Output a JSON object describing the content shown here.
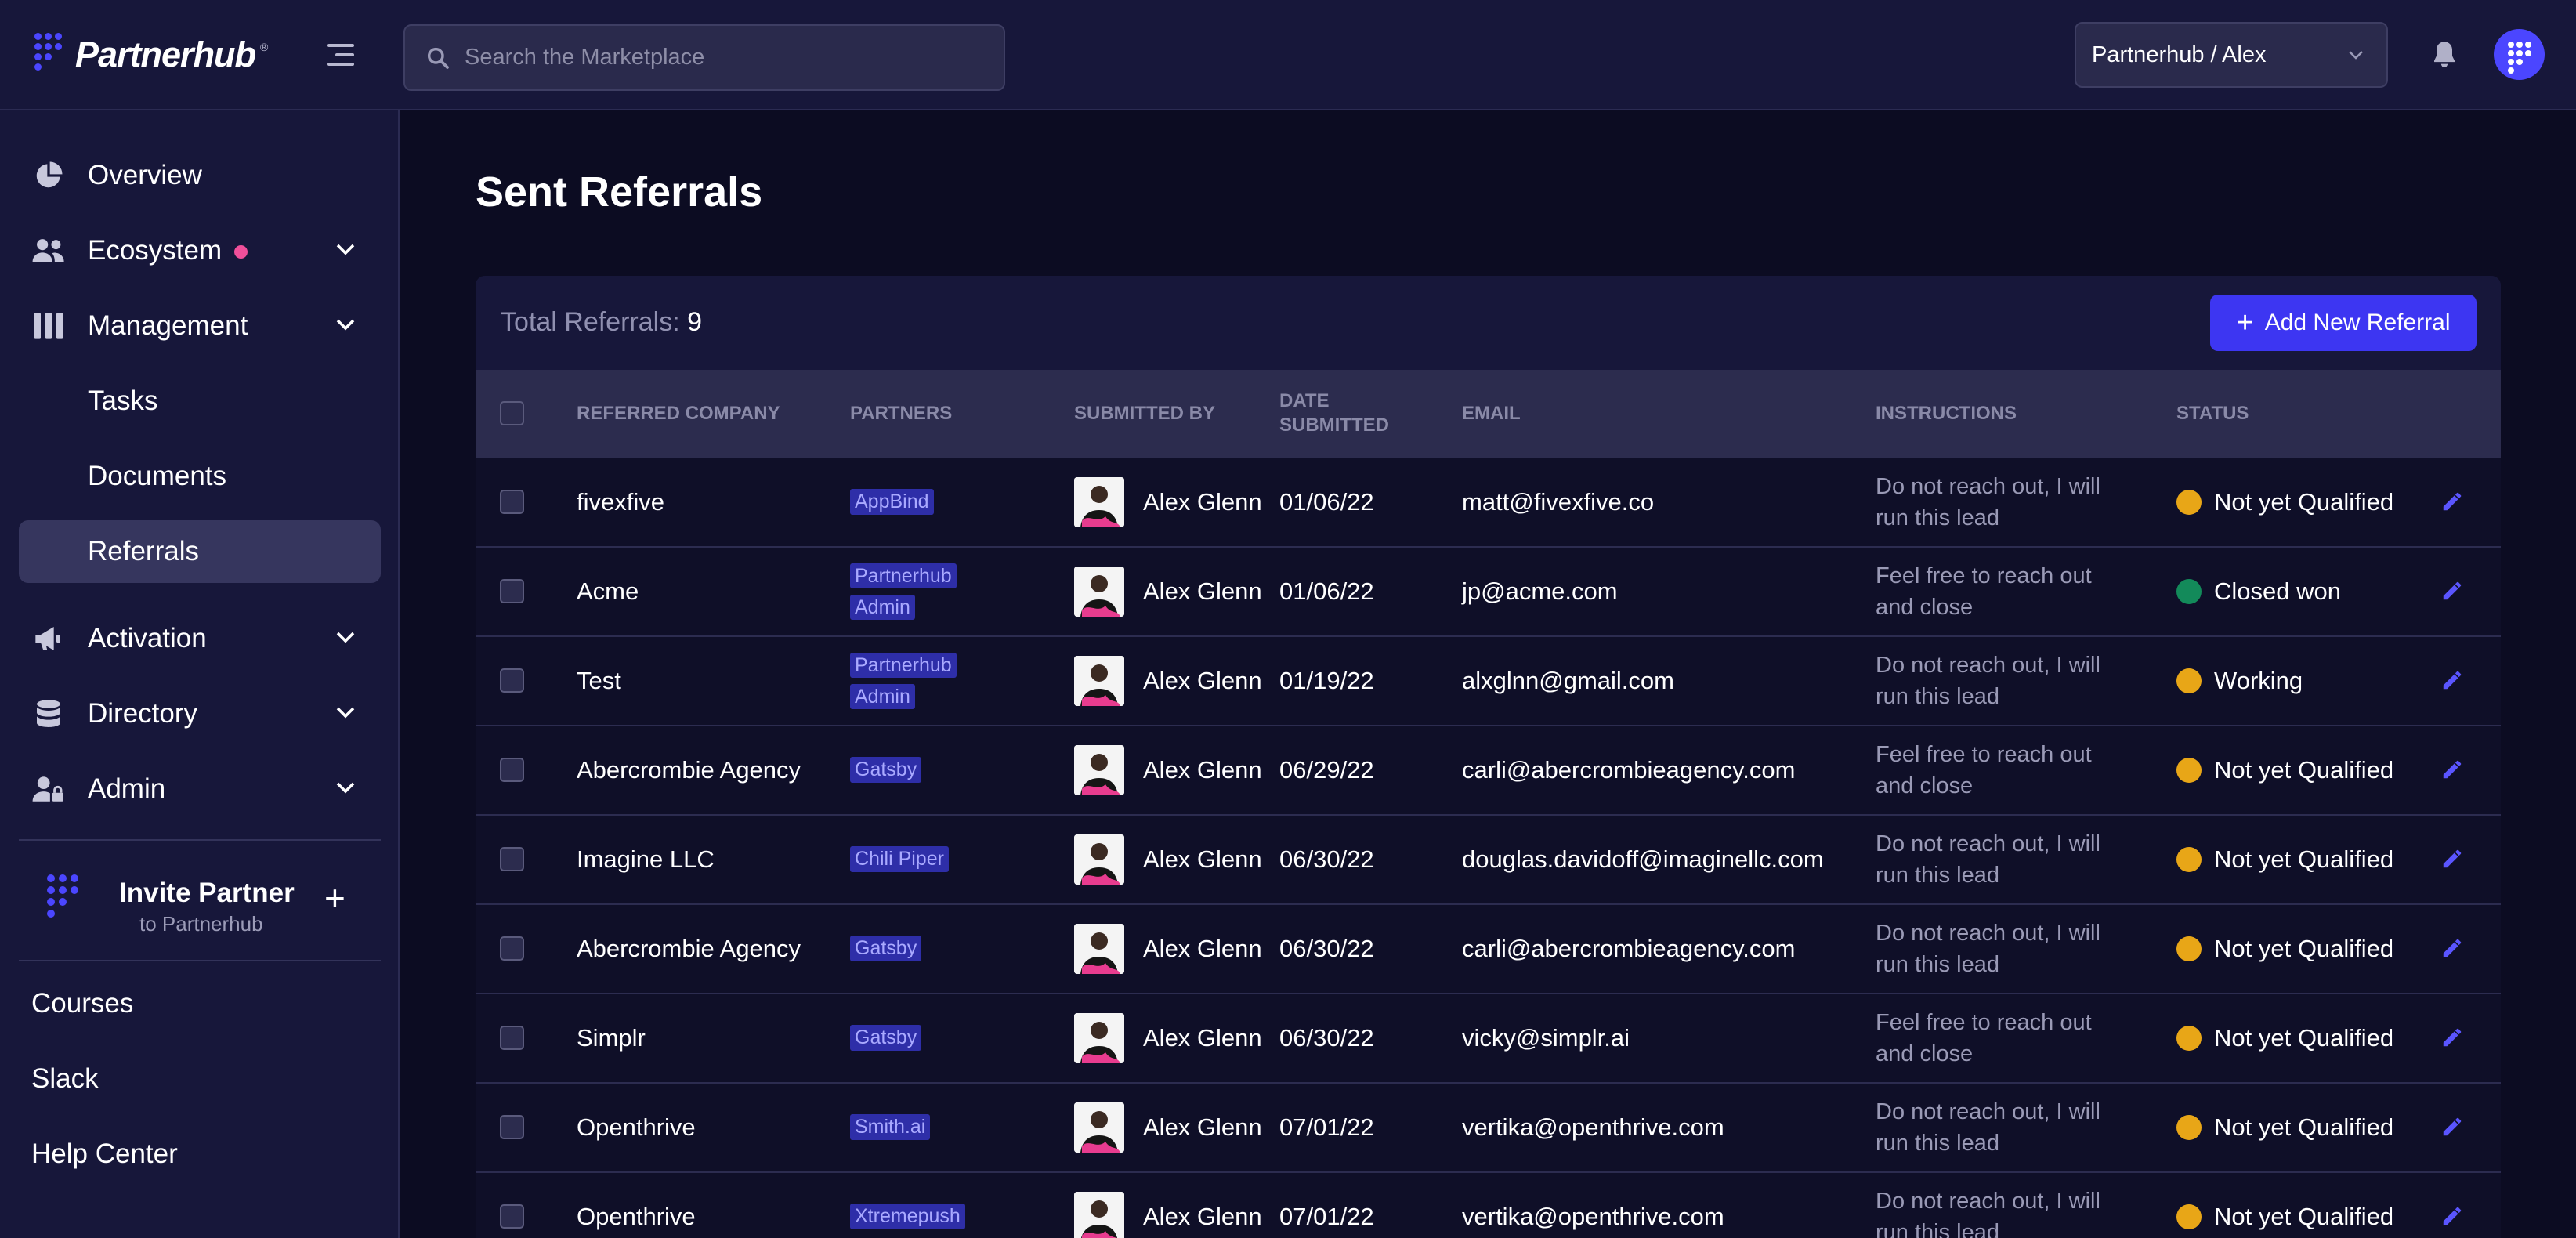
{
  "brand": {
    "name": "Partnerhub",
    "reg": "®",
    "accent": "#4b46ff"
  },
  "search": {
    "placeholder": "Search the Marketplace"
  },
  "workspace": {
    "label": "Partnerhub / Alex"
  },
  "sidebar": {
    "items": [
      {
        "label": "Overview",
        "icon": "pie-chart-icon"
      },
      {
        "label": "Ecosystem",
        "icon": "people-icon",
        "has_dot": true
      },
      {
        "label": "Management",
        "icon": "columns-icon"
      },
      {
        "label": "Tasks"
      },
      {
        "label": "Documents"
      },
      {
        "label": "Referrals",
        "active": true
      },
      {
        "label": "Activation",
        "icon": "megaphone-icon"
      },
      {
        "label": "Directory",
        "icon": "database-icon"
      },
      {
        "label": "Admin",
        "icon": "user-lock-icon"
      }
    ],
    "invite": {
      "title": "Invite Partner",
      "subtitle": "to Partnerhub"
    },
    "bottom_links": [
      "Courses",
      "Slack",
      "Help Center"
    ]
  },
  "page": {
    "title": "Sent Referrals"
  },
  "summary": {
    "total_label": "Total Referrals:",
    "total_value": "9"
  },
  "actions": {
    "add_label": "Add New Referral"
  },
  "table": {
    "headers": {
      "company": "REFERRED COMPANY",
      "partners": "PARTNERS",
      "submitted_by": "SUBMITTED BY",
      "date_line1": "DATE",
      "date_line2": "SUBMITTED",
      "email": "EMAIL",
      "instructions": "INSTRUCTIONS",
      "status": "STATUS"
    },
    "rows": [
      {
        "company": "fivexfive",
        "partner_line1": "AppBind",
        "partner_line2": "",
        "submitted_by": "Alex Glenn",
        "date": "01/06/22",
        "email": "matt@fivexfive.co",
        "instr_line1": "Do not reach out, I will",
        "instr_line2": "run this lead",
        "status": "Not yet Qualified",
        "status_color": "#e8a617"
      },
      {
        "company": "Acme",
        "partner_line1": "Partnerhub",
        "partner_line2": "Admin",
        "submitted_by": "Alex Glenn",
        "date": "01/06/22",
        "email": "jp@acme.com",
        "instr_line1": "Feel free to reach out",
        "instr_line2": "and close",
        "status": "Closed won",
        "status_color": "#138a5a"
      },
      {
        "company": "Test",
        "partner_line1": "Partnerhub",
        "partner_line2": "Admin",
        "submitted_by": "Alex Glenn",
        "date": "01/19/22",
        "email": "alxglnn@gmail.com",
        "instr_line1": "Do not reach out, I will",
        "instr_line2": "run this lead",
        "status": "Working",
        "status_color": "#e8a617"
      },
      {
        "company": "Abercrombie Agency",
        "partner_line1": "Gatsby",
        "partner_line2": "",
        "submitted_by": "Alex Glenn",
        "date": "06/29/22",
        "email": "carli@abercrombieagency.com",
        "instr_line1": "Feel free to reach out",
        "instr_line2": "and close",
        "status": "Not yet Qualified",
        "status_color": "#e8a617"
      },
      {
        "company": "Imagine LLC",
        "partner_line1": "Chili Piper",
        "partner_line2": "",
        "submitted_by": "Alex Glenn",
        "date": "06/30/22",
        "email": "douglas.davidoff@imaginellc.com",
        "instr_line1": "Do not reach out, I will",
        "instr_line2": "run this lead",
        "status": "Not yet Qualified",
        "status_color": "#e8a617"
      },
      {
        "company": "Abercrombie Agency",
        "partner_line1": "Gatsby",
        "partner_line2": "",
        "submitted_by": "Alex Glenn",
        "date": "06/30/22",
        "email": "carli@abercrombieagency.com",
        "instr_line1": "Do not reach out, I will",
        "instr_line2": "run this lead",
        "status": "Not yet Qualified",
        "status_color": "#e8a617"
      },
      {
        "company": "Simplr",
        "partner_line1": "Gatsby",
        "partner_line2": "",
        "submitted_by": "Alex Glenn",
        "date": "06/30/22",
        "email": "vicky@simplr.ai",
        "instr_line1": "Feel free to reach out",
        "instr_line2": "and close",
        "status": "Not yet Qualified",
        "status_color": "#e8a617"
      },
      {
        "company": "Openthrive",
        "partner_line1": "Smith.ai",
        "partner_line2": "",
        "submitted_by": "Alex Glenn",
        "date": "07/01/22",
        "email": "vertika@openthrive.com",
        "instr_line1": "Do not reach out, I will",
        "instr_line2": "run this lead",
        "status": "Not yet Qualified",
        "status_color": "#e8a617"
      },
      {
        "company": "Openthrive",
        "partner_line1": "Xtremepush",
        "partner_line2": "",
        "submitted_by": "Alex Glenn",
        "date": "07/01/22",
        "email": "vertika@openthrive.com",
        "instr_line1": "Do not reach out, I will",
        "instr_line2": "run this lead",
        "status": "Not yet Qualified",
        "status_color": "#e8a617"
      }
    ]
  }
}
